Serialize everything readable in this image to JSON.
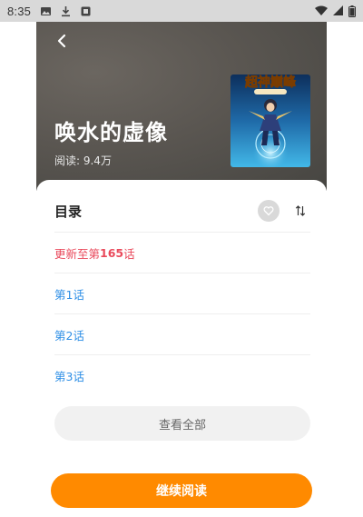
{
  "status_bar": {
    "time": "8:35",
    "icons": [
      "image-icon",
      "download-icon",
      "notification-icon",
      "wifi-icon",
      "signal-icon",
      "battery-icon"
    ]
  },
  "header": {
    "back_icon": "chevron-left-icon",
    "title": "唤水的虚像",
    "reads": "阅读: 9.4万",
    "cover_text": "超神巅峰"
  },
  "catalog": {
    "label": "目录",
    "update_prefix": "更新至第",
    "update_number": "165",
    "update_suffix": "话",
    "chapters": [
      "第1话",
      "第2话",
      "第3话"
    ],
    "view_all": "查看全部"
  },
  "actions": {
    "continue": "继续阅读"
  },
  "colors": {
    "accent_orange": "#ff8a00",
    "chapter_blue": "#2f8fe6",
    "update_red": "#e9495b"
  }
}
